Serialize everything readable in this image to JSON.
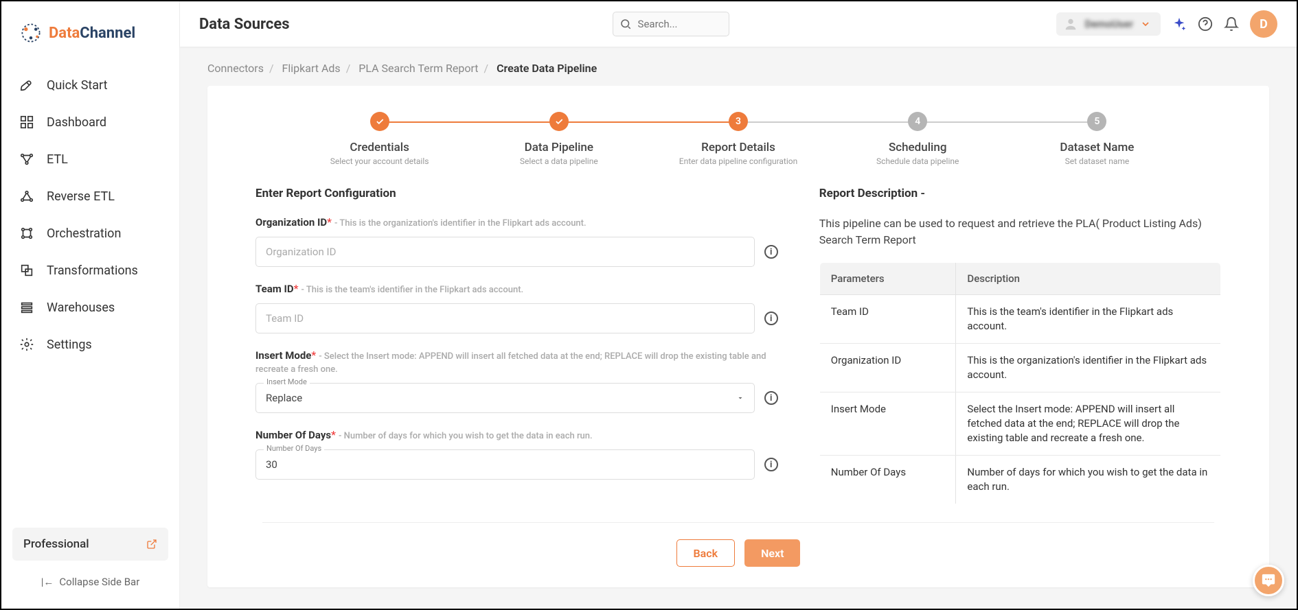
{
  "app": {
    "brand_a": "Data",
    "brand_b": "Channel"
  },
  "sidebar": {
    "items": [
      {
        "label": "Quick Start"
      },
      {
        "label": "Dashboard"
      },
      {
        "label": "ETL"
      },
      {
        "label": "Reverse ETL"
      },
      {
        "label": "Orchestration"
      },
      {
        "label": "Transformations"
      },
      {
        "label": "Warehouses"
      },
      {
        "label": "Settings"
      }
    ],
    "plan_label": "Professional",
    "collapse_label": "Collapse Side Bar"
  },
  "header": {
    "page_title": "Data Sources",
    "search_placeholder": "Search...",
    "user_name": "DemoUser",
    "avatar_letter": "D"
  },
  "breadcrumbs": {
    "items": [
      "Connectors",
      "Flipkart Ads",
      "PLA Search Term Report",
      "Create Data Pipeline"
    ]
  },
  "stepper": [
    {
      "title": "Credentials",
      "sub": "Select your account details",
      "state": "done"
    },
    {
      "title": "Data Pipeline",
      "sub": "Select a data pipeline",
      "state": "done"
    },
    {
      "title": "Report Details",
      "sub": "Enter data pipeline configuration",
      "state": "active",
      "num": "3"
    },
    {
      "title": "Scheduling",
      "sub": "Schedule data pipeline",
      "state": "pending",
      "num": "4"
    },
    {
      "title": "Dataset Name",
      "sub": "Set dataset name",
      "state": "pending",
      "num": "5"
    }
  ],
  "form": {
    "section_title": "Enter Report Configuration",
    "fields": {
      "org": {
        "label": "Organization ID",
        "hint": "- This is the organization's identifier in the Flipkart ads account.",
        "placeholder": "Organization ID",
        "value": ""
      },
      "team": {
        "label": "Team ID",
        "hint": "- This is the team's identifier in the Flipkart ads account.",
        "placeholder": "Team ID",
        "value": ""
      },
      "insert": {
        "label": "Insert Mode",
        "hint": "- Select the Insert mode: APPEND will insert all fetched data at the end; REPLACE will drop the existing table and recreate a fresh one.",
        "float_label": "Insert Mode",
        "value": "Replace"
      },
      "days": {
        "label": "Number Of Days",
        "hint": "- Number of days for which you wish to get the data in each run.",
        "float_label": "Number Of Days",
        "value": "30"
      }
    },
    "info_icon": "i"
  },
  "description": {
    "heading": "Report Description -",
    "text": "This pipeline can be used to request and retrieve the PLA( Product Listing Ads) Search Term Report",
    "columns": {
      "param": "Parameters",
      "desc": "Description"
    },
    "rows": [
      {
        "param": "Team ID",
        "desc": "This is the team's identifier in the Flipkart ads account."
      },
      {
        "param": "Organization ID",
        "desc": "This is the organization's identifier in the Flipkart ads account."
      },
      {
        "param": "Insert Mode",
        "desc": "Select the Insert mode: APPEND will insert all fetched data at the end; REPLACE will drop the existing table and recreate a fresh one."
      },
      {
        "param": "Number Of Days",
        "desc": "Number of days for which you wish to get the data in each run."
      }
    ]
  },
  "footer": {
    "back": "Back",
    "next": "Next"
  }
}
